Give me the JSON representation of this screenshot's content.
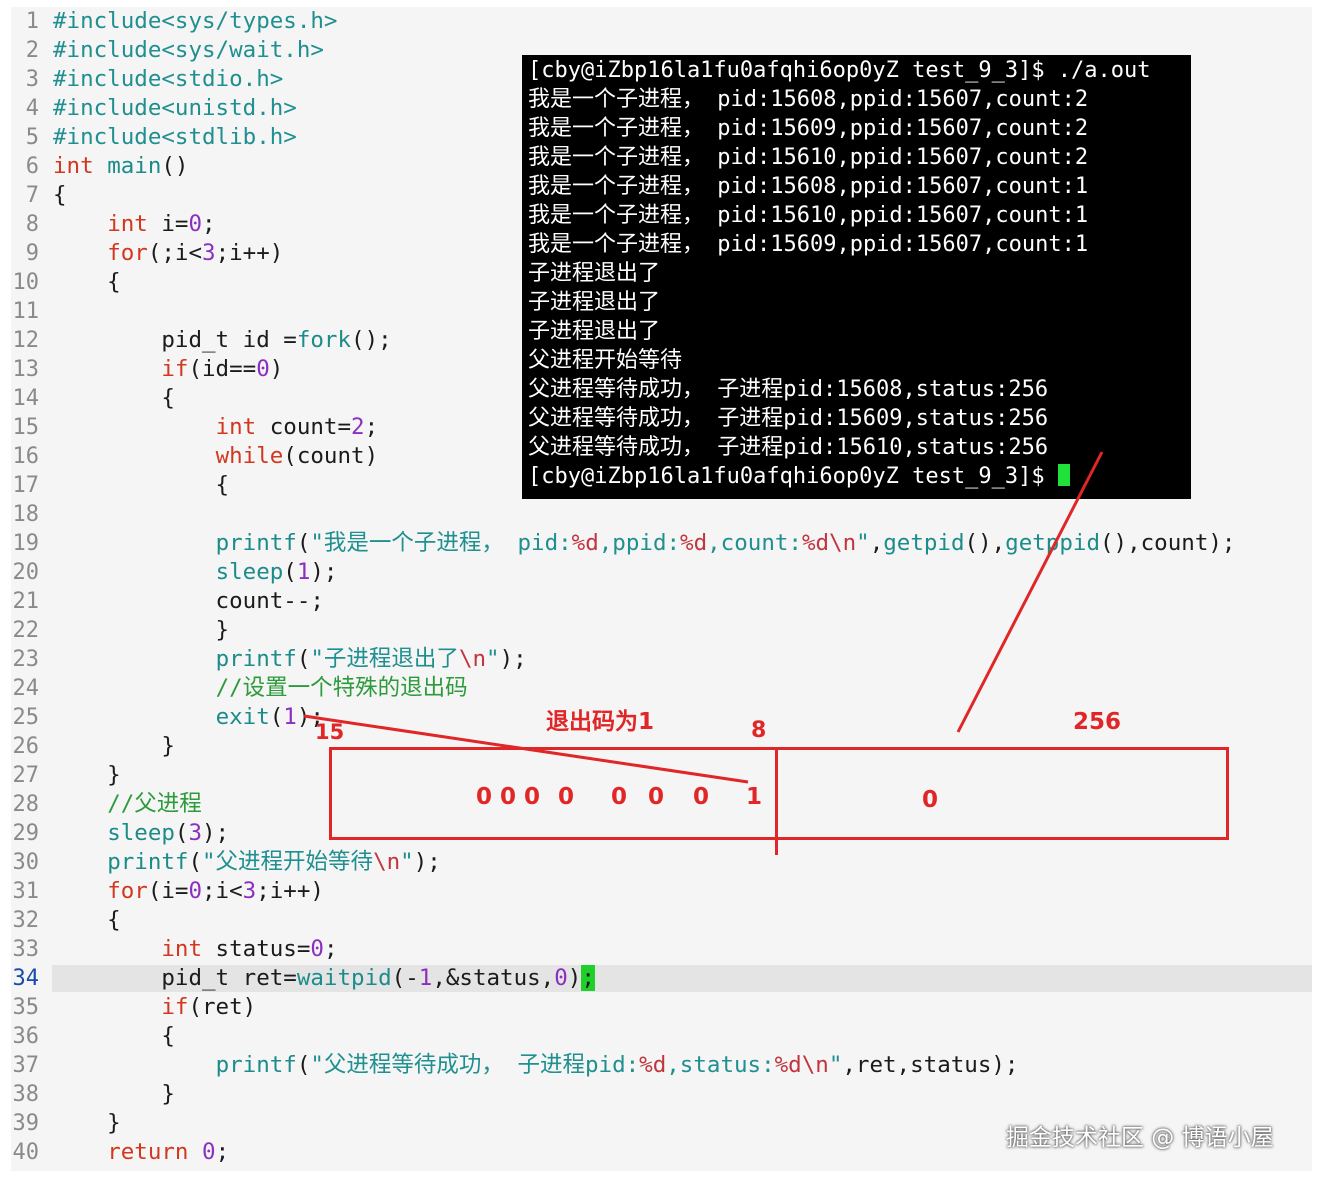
{
  "editor": {
    "lines": [
      {
        "n": "1",
        "code": [
          {
            "t": "#include<sys/types.h>",
            "c": "str"
          }
        ]
      },
      {
        "n": "2",
        "code": [
          {
            "t": "#include<sys/wait.h>",
            "c": "str"
          }
        ]
      },
      {
        "n": "3",
        "code": [
          {
            "t": "#include<stdio.h>",
            "c": "str"
          }
        ]
      },
      {
        "n": "4",
        "code": [
          {
            "t": "#include<unistd.h>",
            "c": "str"
          }
        ]
      },
      {
        "n": "5",
        "code": [
          {
            "t": "#include<stdlib.h>",
            "c": "str"
          }
        ]
      },
      {
        "n": "6",
        "code": [
          {
            "t": "int ",
            "c": "kw"
          },
          {
            "t": "main",
            "c": "fn"
          },
          {
            "t": "()",
            "c": ""
          }
        ]
      },
      {
        "n": "7",
        "code": [
          {
            "t": "{",
            "c": ""
          }
        ]
      },
      {
        "n": "8",
        "code": [
          {
            "t": "    ",
            "c": ""
          },
          {
            "t": "int",
            "c": "kw"
          },
          {
            "t": " i=",
            "c": ""
          },
          {
            "t": "0",
            "c": "num"
          },
          {
            "t": ";",
            "c": ""
          }
        ]
      },
      {
        "n": "9",
        "code": [
          {
            "t": "    ",
            "c": ""
          },
          {
            "t": "for",
            "c": "kw"
          },
          {
            "t": "(;i<",
            "c": ""
          },
          {
            "t": "3",
            "c": "num"
          },
          {
            "t": ";i++)",
            "c": ""
          }
        ]
      },
      {
        "n": "10",
        "code": [
          {
            "t": "    {",
            "c": ""
          }
        ]
      },
      {
        "n": "11",
        "code": []
      },
      {
        "n": "12",
        "code": [
          {
            "t": "        pid_t id =",
            "c": ""
          },
          {
            "t": "fork",
            "c": "fn"
          },
          {
            "t": "();",
            "c": ""
          }
        ]
      },
      {
        "n": "13",
        "code": [
          {
            "t": "        ",
            "c": ""
          },
          {
            "t": "if",
            "c": "kw"
          },
          {
            "t": "(id==",
            "c": ""
          },
          {
            "t": "0",
            "c": "num"
          },
          {
            "t": ")",
            "c": ""
          }
        ]
      },
      {
        "n": "14",
        "code": [
          {
            "t": "        {",
            "c": ""
          }
        ]
      },
      {
        "n": "15",
        "code": [
          {
            "t": "            ",
            "c": ""
          },
          {
            "t": "int",
            "c": "kw"
          },
          {
            "t": " count=",
            "c": ""
          },
          {
            "t": "2",
            "c": "num"
          },
          {
            "t": ";",
            "c": ""
          }
        ]
      },
      {
        "n": "16",
        "code": [
          {
            "t": "            ",
            "c": ""
          },
          {
            "t": "while",
            "c": "kw"
          },
          {
            "t": "(count)",
            "c": ""
          }
        ]
      },
      {
        "n": "17",
        "code": [
          {
            "t": "            {",
            "c": ""
          }
        ]
      },
      {
        "n": "18",
        "code": []
      },
      {
        "n": "19",
        "code": [
          {
            "t": "            ",
            "c": ""
          },
          {
            "t": "printf",
            "c": "fn"
          },
          {
            "t": "(",
            "c": ""
          },
          {
            "t": "\"我是一个子进程， pid:",
            "c": "str"
          },
          {
            "t": "%d",
            "c": "esc"
          },
          {
            "t": ",ppid:",
            "c": "str"
          },
          {
            "t": "%d",
            "c": "esc"
          },
          {
            "t": ",count:",
            "c": "str"
          },
          {
            "t": "%d\\n",
            "c": "esc"
          },
          {
            "t": "\"",
            "c": "str"
          },
          {
            "t": ",",
            "c": ""
          },
          {
            "t": "getpid",
            "c": "fn"
          },
          {
            "t": "(),",
            "c": ""
          },
          {
            "t": "getppid",
            "c": "fn"
          },
          {
            "t": "(),count);",
            "c": ""
          }
        ]
      },
      {
        "n": "20",
        "code": [
          {
            "t": "            ",
            "c": ""
          },
          {
            "t": "sleep",
            "c": "fn"
          },
          {
            "t": "(",
            "c": ""
          },
          {
            "t": "1",
            "c": "num"
          },
          {
            "t": ");",
            "c": ""
          }
        ]
      },
      {
        "n": "21",
        "code": [
          {
            "t": "            count--;",
            "c": ""
          }
        ]
      },
      {
        "n": "22",
        "code": [
          {
            "t": "            }",
            "c": ""
          }
        ]
      },
      {
        "n": "23",
        "code": [
          {
            "t": "            ",
            "c": ""
          },
          {
            "t": "printf",
            "c": "fn"
          },
          {
            "t": "(",
            "c": ""
          },
          {
            "t": "\"子进程退出了",
            "c": "str"
          },
          {
            "t": "\\n",
            "c": "esc"
          },
          {
            "t": "\"",
            "c": "str"
          },
          {
            "t": ");",
            "c": ""
          }
        ]
      },
      {
        "n": "24",
        "code": [
          {
            "t": "            ",
            "c": ""
          },
          {
            "t": "//设置一个特殊的退出码",
            "c": "cm"
          }
        ]
      },
      {
        "n": "25",
        "code": [
          {
            "t": "            ",
            "c": ""
          },
          {
            "t": "exit",
            "c": "fn"
          },
          {
            "t": "(",
            "c": ""
          },
          {
            "t": "1",
            "c": "num"
          },
          {
            "t": ");",
            "c": ""
          }
        ]
      },
      {
        "n": "26",
        "code": [
          {
            "t": "        }",
            "c": ""
          }
        ]
      },
      {
        "n": "27",
        "code": [
          {
            "t": "    }",
            "c": ""
          }
        ]
      },
      {
        "n": "28",
        "code": [
          {
            "t": "    ",
            "c": ""
          },
          {
            "t": "//父进程",
            "c": "cm"
          }
        ]
      },
      {
        "n": "29",
        "code": [
          {
            "t": "    ",
            "c": ""
          },
          {
            "t": "sleep",
            "c": "fn"
          },
          {
            "t": "(",
            "c": ""
          },
          {
            "t": "3",
            "c": "num"
          },
          {
            "t": ");",
            "c": ""
          }
        ]
      },
      {
        "n": "30",
        "code": [
          {
            "t": "    ",
            "c": ""
          },
          {
            "t": "printf",
            "c": "fn"
          },
          {
            "t": "(",
            "c": ""
          },
          {
            "t": "\"父进程开始等待",
            "c": "str"
          },
          {
            "t": "\\n",
            "c": "esc"
          },
          {
            "t": "\"",
            "c": "str"
          },
          {
            "t": ");",
            "c": ""
          }
        ]
      },
      {
        "n": "31",
        "code": [
          {
            "t": "    ",
            "c": ""
          },
          {
            "t": "for",
            "c": "kw"
          },
          {
            "t": "(i=",
            "c": ""
          },
          {
            "t": "0",
            "c": "num"
          },
          {
            "t": ";i<",
            "c": ""
          },
          {
            "t": "3",
            "c": "num"
          },
          {
            "t": ";i++)",
            "c": ""
          }
        ]
      },
      {
        "n": "32",
        "code": [
          {
            "t": "    {",
            "c": ""
          }
        ]
      },
      {
        "n": "33",
        "code": [
          {
            "t": "        ",
            "c": ""
          },
          {
            "t": "int",
            "c": "kw"
          },
          {
            "t": " status=",
            "c": ""
          },
          {
            "t": "0",
            "c": "num"
          },
          {
            "t": ";",
            "c": ""
          }
        ]
      },
      {
        "n": "34",
        "current": true,
        "code": [
          {
            "t": "        pid_t ret=",
            "c": ""
          },
          {
            "t": "waitpid",
            "c": "fn"
          },
          {
            "t": "(-",
            "c": ""
          },
          {
            "t": "1",
            "c": "num"
          },
          {
            "t": ",&status,",
            "c": ""
          },
          {
            "t": "0",
            "c": "num"
          },
          {
            "t": ")",
            "c": ""
          },
          {
            "t": ";",
            "c": "cursor-box"
          }
        ]
      },
      {
        "n": "35",
        "code": [
          {
            "t": "        ",
            "c": ""
          },
          {
            "t": "if",
            "c": "kw"
          },
          {
            "t": "(ret)",
            "c": ""
          }
        ]
      },
      {
        "n": "36",
        "code": [
          {
            "t": "        {",
            "c": ""
          }
        ]
      },
      {
        "n": "37",
        "code": [
          {
            "t": "            ",
            "c": ""
          },
          {
            "t": "printf",
            "c": "fn"
          },
          {
            "t": "(",
            "c": ""
          },
          {
            "t": "\"父进程等待成功， 子进程pid:",
            "c": "str"
          },
          {
            "t": "%d",
            "c": "esc"
          },
          {
            "t": ",status:",
            "c": "str"
          },
          {
            "t": "%d\\n",
            "c": "esc"
          },
          {
            "t": "\"",
            "c": "str"
          },
          {
            "t": ",ret,status);",
            "c": ""
          }
        ]
      },
      {
        "n": "38",
        "code": [
          {
            "t": "        }",
            "c": ""
          }
        ]
      },
      {
        "n": "39",
        "code": [
          {
            "t": "    }",
            "c": ""
          }
        ]
      },
      {
        "n": "40",
        "code": [
          {
            "t": "    ",
            "c": ""
          },
          {
            "t": "return",
            "c": "kw"
          },
          {
            "t": " ",
            "c": ""
          },
          {
            "t": "0",
            "c": "num"
          },
          {
            "t": ";",
            "c": ""
          }
        ]
      }
    ]
  },
  "terminal": {
    "lines": [
      "[cby@iZbp16la1fu0afqhi6op0yZ test_9_3]$ ./a.out",
      "我是一个子进程， pid:15608,ppid:15607,count:2",
      "我是一个子进程， pid:15609,ppid:15607,count:2",
      "我是一个子进程， pid:15610,ppid:15607,count:2",
      "我是一个子进程， pid:15608,ppid:15607,count:1",
      "我是一个子进程， pid:15610,ppid:15607,count:1",
      "我是一个子进程， pid:15609,ppid:15607,count:1",
      "子进程退出了",
      "子进程退出了",
      "子进程退出了",
      "父进程开始等待",
      "父进程等待成功， 子进程pid:15608,status:256",
      "父进程等待成功， 子进程pid:15609,status:256",
      "父进程等待成功， 子进程pid:15610,status:256"
    ],
    "prompt": "[cby@iZbp16la1fu0afqhi6op0yZ test_9_3]$ "
  },
  "annotations": {
    "exit_code_label": "退出码为1",
    "bit_15": "15",
    "bit_8": "8",
    "value_256": "256",
    "high_bits": "0 0 0",
    "bit_a": "0",
    "bit_b": "0",
    "bit_c": "0",
    "bit_d": "0",
    "bit_one": "1",
    "low_byte": "0",
    "color": "#e02626"
  },
  "watermark": "掘金技术社区 @ 博语小屋"
}
